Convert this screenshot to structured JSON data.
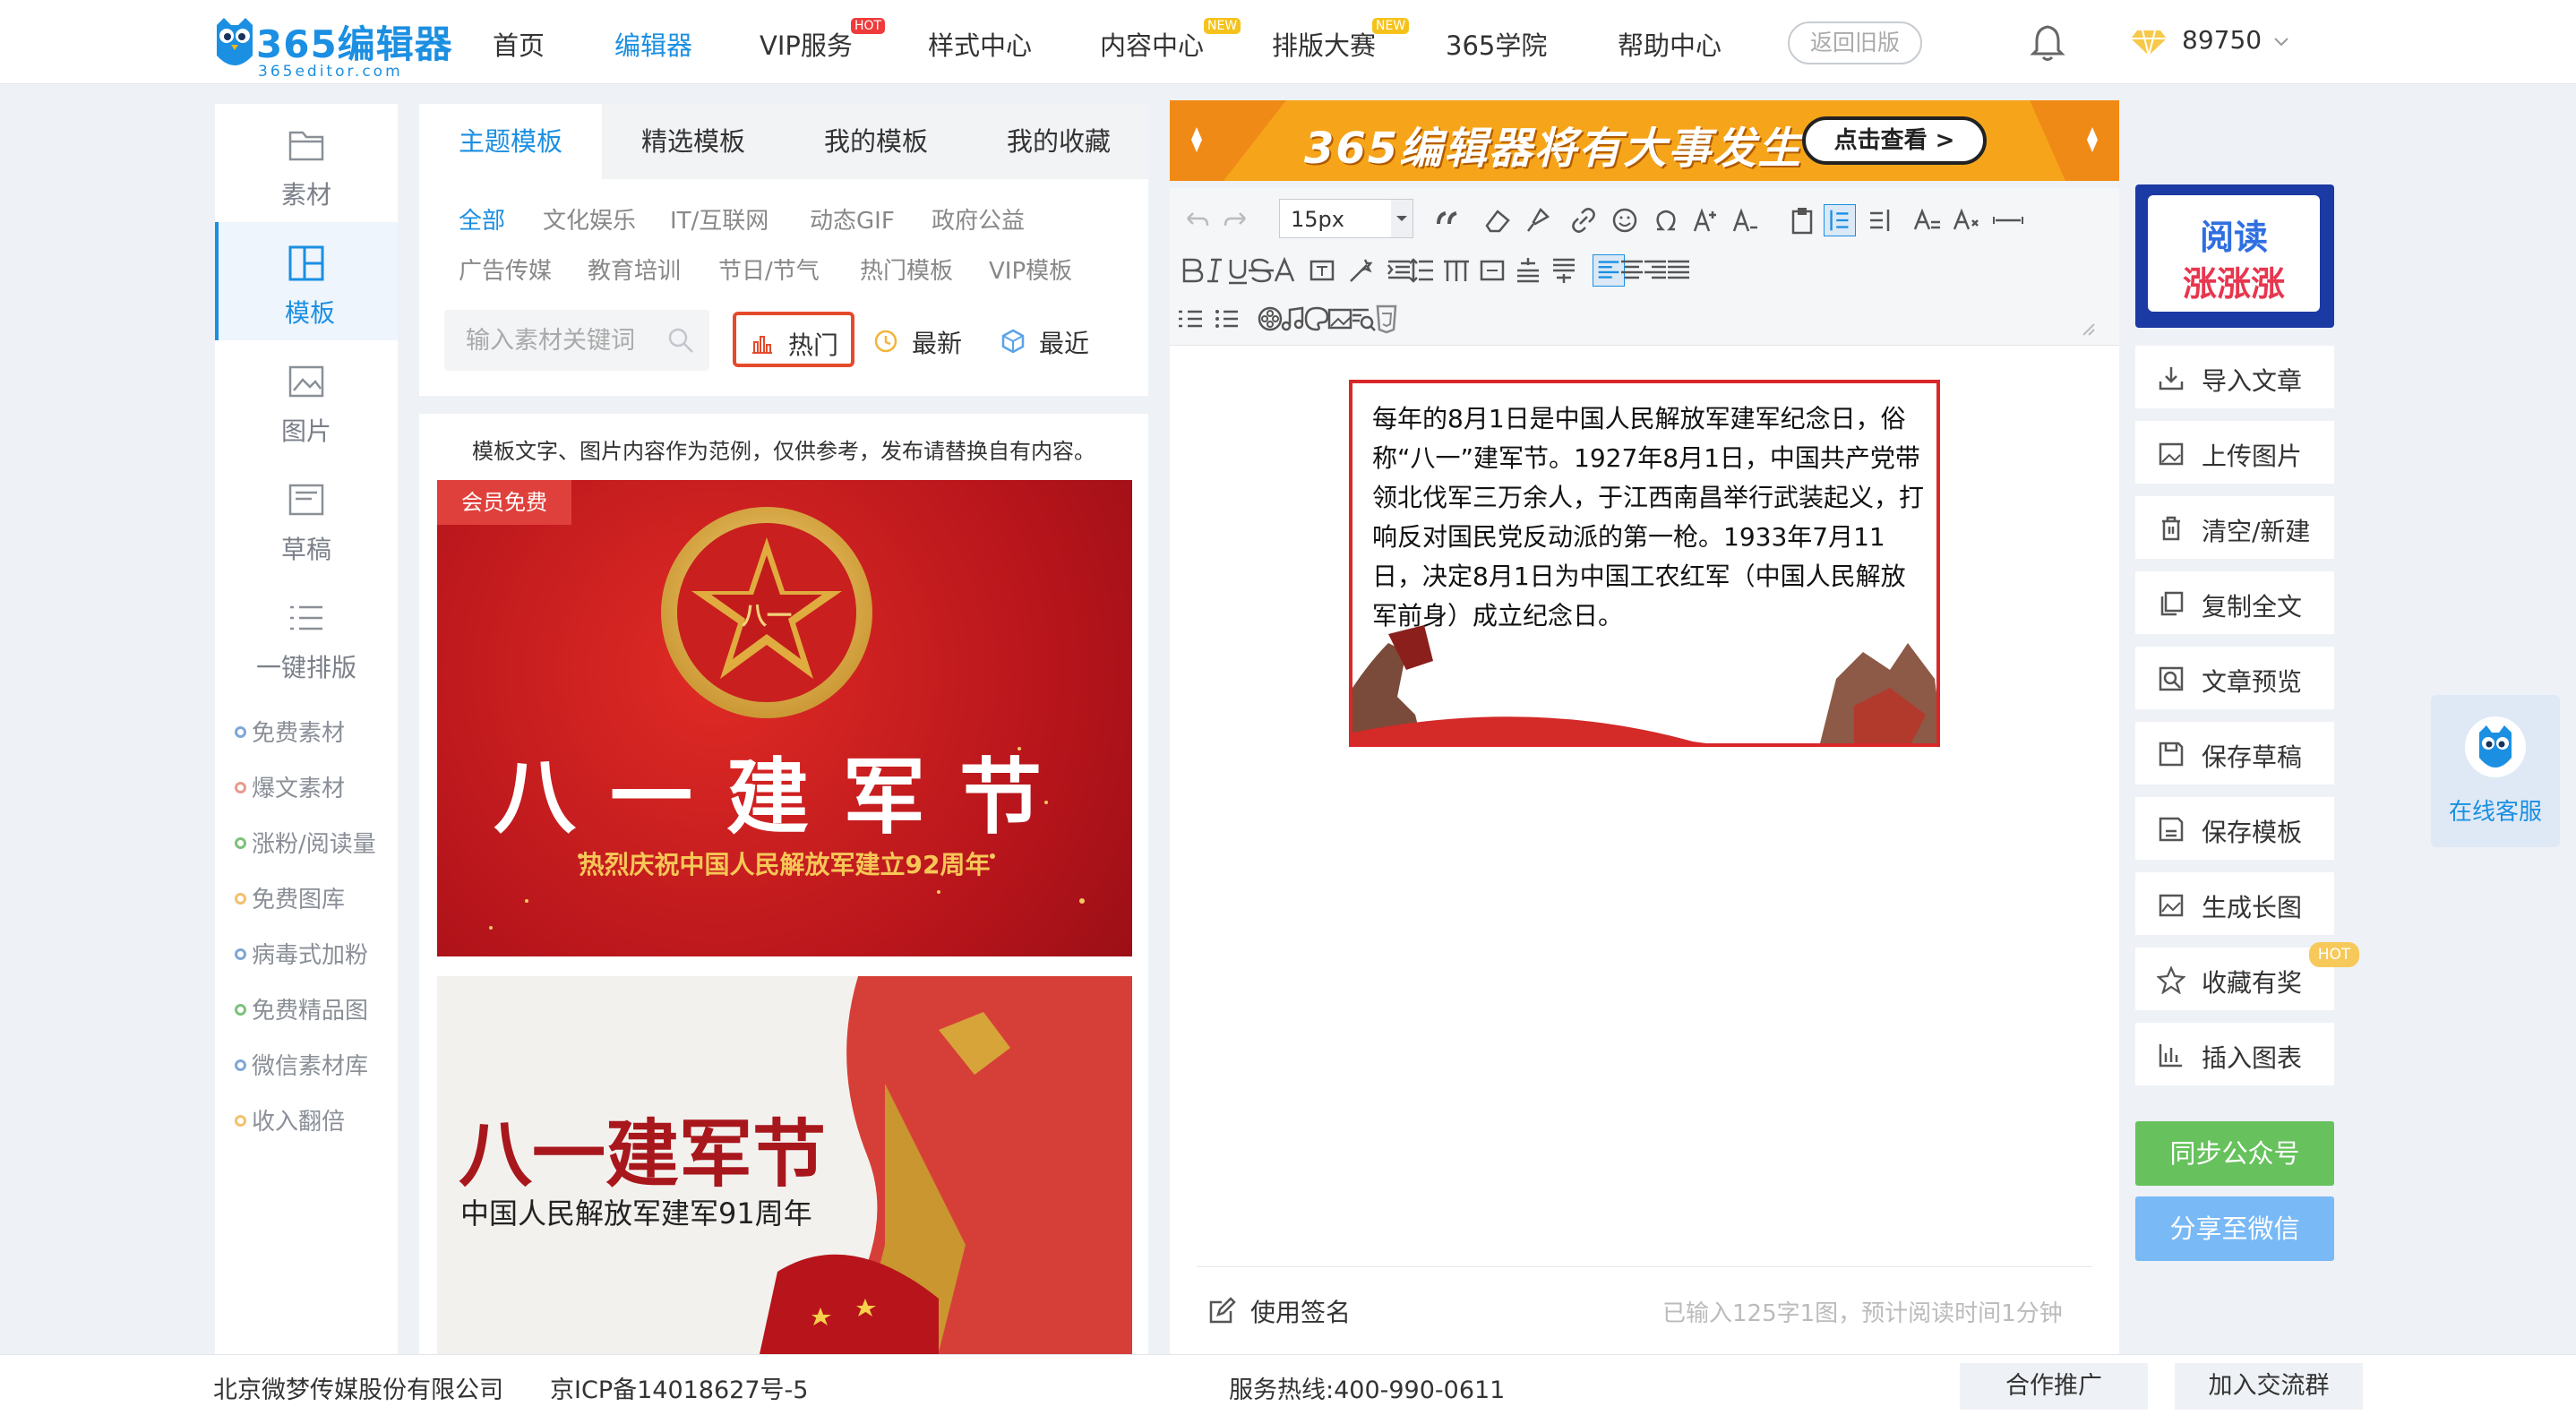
{
  "brand": {
    "name": "365编辑器",
    "sub": "365editor.com"
  },
  "nav": {
    "items": [
      {
        "label": "首页"
      },
      {
        "label": "编辑器"
      },
      {
        "label": "VIP服务",
        "badge": "HOT"
      },
      {
        "label": "样式中心"
      },
      {
        "label": "内容中心",
        "badge": "NEW"
      },
      {
        "label": "排版大赛",
        "badge": "NEW"
      },
      {
        "label": "365学院"
      },
      {
        "label": "帮助中心"
      }
    ],
    "old_version": "返回旧版",
    "coins": "89750"
  },
  "sidebar": {
    "items": [
      {
        "label": "素材"
      },
      {
        "label": "模板"
      },
      {
        "label": "图片"
      },
      {
        "label": "草稿"
      },
      {
        "label": "一键排版"
      }
    ],
    "links": [
      {
        "label": "免费素材",
        "color": "#7fa7d6"
      },
      {
        "label": "爆文素材",
        "color": "#e89a8e"
      },
      {
        "label": "涨粉/阅读量",
        "color": "#7cc17a"
      },
      {
        "label": "免费图库",
        "color": "#f2c16a"
      },
      {
        "label": "病毒式加粉",
        "color": "#7fa7d6"
      },
      {
        "label": "免费精品图",
        "color": "#7cc17a"
      },
      {
        "label": "微信素材库",
        "color": "#7fa7d6"
      },
      {
        "label": "收入翻倍",
        "color": "#f2c16a"
      }
    ]
  },
  "templates": {
    "tabs": [
      "主题模板",
      "精选模板",
      "我的模板",
      "我的收藏"
    ],
    "categories_row1": [
      "全部",
      "文化娱乐",
      "IT/互联网",
      "动态GIF",
      "政府公益"
    ],
    "categories_row2": [
      "广告传媒",
      "教育培训",
      "节日/节气",
      "热门模板",
      "VIP模板"
    ],
    "search_placeholder": "输入素材关键词",
    "sort": {
      "hot": "热门",
      "newest": "最新",
      "recent": "最近"
    },
    "note": "模板文字、图片内容作为范例，仅供参考，发布请替换自有内容。",
    "card1": {
      "tag": "会员免费",
      "title": "八一建军节",
      "subtitle": "热烈庆祝中国人民解放军建立92周年",
      "emblem": "八一"
    },
    "card2": {
      "title": "八一建军节",
      "subtitle": "中国人民解放军建军91周年"
    }
  },
  "banner": {
    "text": "365编辑器将有大事发生",
    "button": "点击查看 >"
  },
  "editor": {
    "font_size": "15px",
    "article": "每年的8月1日是中国人民解放军建军纪念日，俗称“八一”建军节。1927年8月1日，中国共产党带领北伐军三万余人，于江西南昌举行武装起义，打响反对国民党反动派的第一枪。1933年7月11日，决定8月1日为中国工农红军（中国人民解放军前身）成立纪念日。",
    "signature": "使用签名",
    "word_count": "已输入125字1图，预计阅读时间1分钟"
  },
  "right_panel": {
    "ad_line1": "阅读",
    "ad_line2": "涨涨涨",
    "buttons": [
      "导入文章",
      "上传图片",
      "清空/新建",
      "复制全文",
      "文章预览",
      "保存草稿",
      "保存模板",
      "生成长图",
      "收藏有奖",
      "插入图表"
    ],
    "hot_badge": "HOT",
    "sync": "同步公众号",
    "share": "分享至微信",
    "service": "在线客服"
  },
  "footer": {
    "company": "北京微梦传媒股份有限公司",
    "icp": "京ICP备14018627号-5",
    "hotline": "服务热线:400-990-0611",
    "partner": "合作推广",
    "group": "加入交流群"
  },
  "colors": {
    "accent": "#1b8fe2",
    "hot_border": "#e44a2b",
    "sync": "#67c25e",
    "share": "#78b9f6"
  }
}
